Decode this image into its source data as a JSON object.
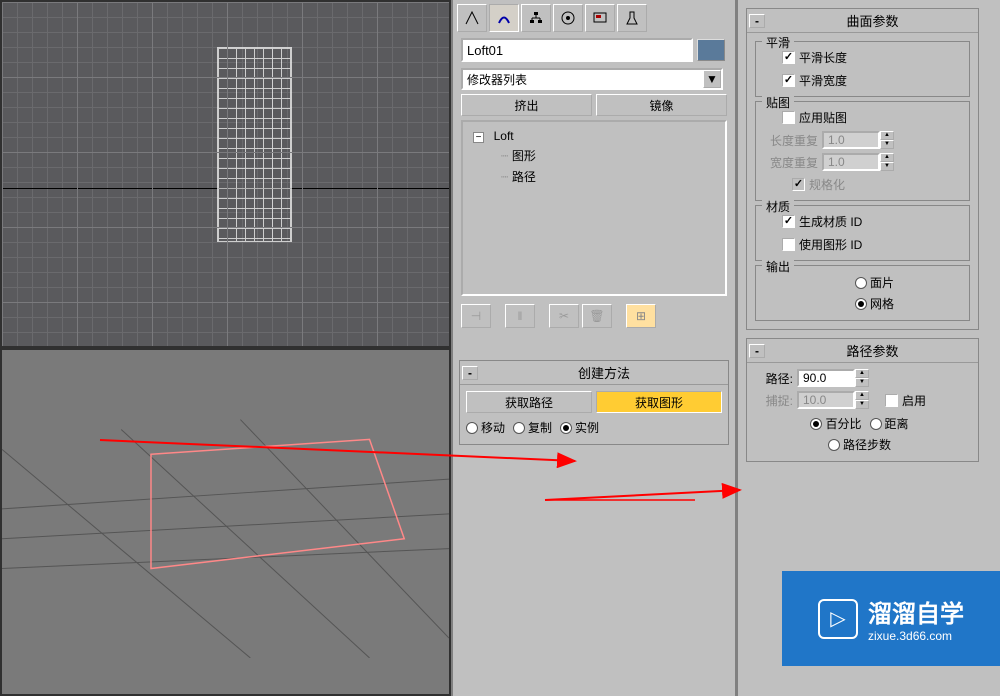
{
  "object_name": "Loft01",
  "modifier_dropdown": "修改器列表",
  "sub_buttons": {
    "extrude": "挤出",
    "mirror": "镜像"
  },
  "tree": {
    "root": "Loft",
    "child1": "图形",
    "child2": "路径"
  },
  "creation_method": {
    "title": "创建方法",
    "get_path": "获取路径",
    "get_shape": "获取图形",
    "move": "移动",
    "copy": "复制",
    "instance": "实例"
  },
  "surface_params": {
    "title": "曲面参数",
    "smooth_section": "平滑",
    "smooth_length": "平滑长度",
    "smooth_width": "平滑宽度",
    "mapping_section": "贴图",
    "apply_mapping": "应用贴图",
    "length_repeat": "长度重复",
    "length_repeat_val": "1.0",
    "width_repeat": "宽度重复",
    "width_repeat_val": "1.0",
    "normalize": "规格化",
    "material_section": "材质",
    "gen_material_id": "生成材质 ID",
    "use_shape_id": "使用图形 ID",
    "output_section": "输出",
    "output_patch": "面片",
    "output_mesh": "网格"
  },
  "path_params": {
    "title": "路径参数",
    "path_label": "路径:",
    "path_val": "90.0",
    "snap_label": "捕捉:",
    "snap_val": "10.0",
    "enable": "启用",
    "percent": "百分比",
    "distance": "距离",
    "path_steps": "路径步数"
  },
  "watermark": {
    "main": "溜溜自学",
    "sub": "zixue.3d66.com"
  }
}
